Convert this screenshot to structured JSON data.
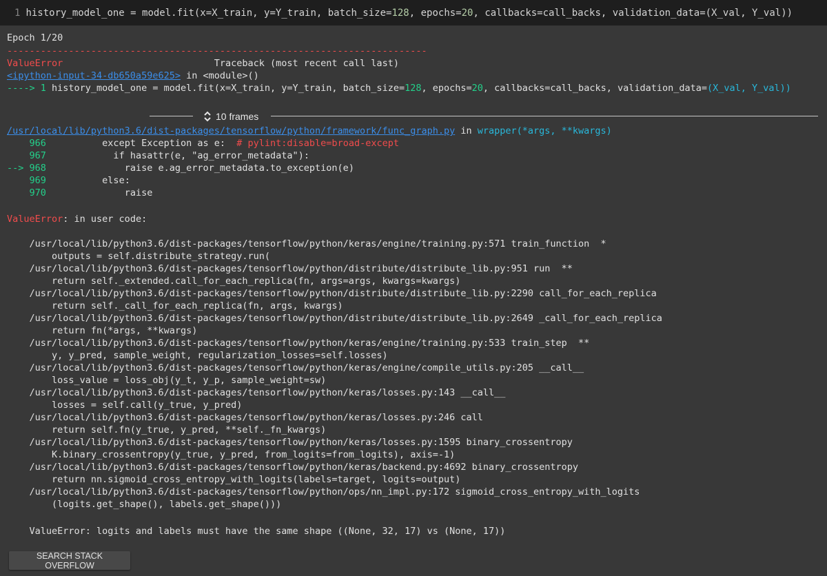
{
  "cell": {
    "line_number": "1",
    "code_prefix": "history_model_one = model.fit(x=X_train, y=Y_train, batch_size=",
    "batch_size": "128",
    "code_mid": ", epochs=",
    "epochs": "20",
    "code_suffix": ", callbacks=call_backs, validation_data=(X_val, Y_val))"
  },
  "output": {
    "epoch": "Epoch 1/20",
    "dash_rule": "---------------------------------------------------------------------------",
    "error_name": "ValueError",
    "traceback_header": "Traceback (most recent call last)",
    "ipython_link": "<ipython-input-34-db650a59e625>",
    "in_module": " in <module>()",
    "arrow_line_prefix": "----> 1 ",
    "arrow_code_a": "history_model_one = model.fit(x=X_train, y=Y_train, batch_size=",
    "arrow_bs": "128",
    "arrow_code_b": ", epochs=",
    "arrow_ep": "20",
    "arrow_code_c": ", callbacks=call_backs, validation_data=",
    "arrow_code_d": "(X_val, Y_val))",
    "frames_label": "10 frames",
    "file_link": "/usr/local/lib/python3.6/dist-packages/tensorflow/python/framework/func_graph.py",
    "file_in": " in ",
    "file_func": "wrapper(*args, **kwargs)",
    "src_lines": [
      {
        "marker": "    966 ",
        "code_kw": "         except",
        "code_rest": " Exception ",
        "code_as": "as",
        "code_tail": " e:  ",
        "comment": "# pylint:disable=broad-except"
      },
      {
        "marker": "    967 ",
        "code_kw": "           if",
        "code_rest": " hasattr(e, ",
        "code_str": "\"ag_error_metadata\"",
        "code_tail": "):"
      },
      {
        "marker": "--> 968 ",
        "code_kw": "             raise",
        "code_rest": " e.ag_error_metadata.to_exception(e)"
      },
      {
        "marker": "    969 ",
        "code_kw": "         else:"
      },
      {
        "marker": "    970 ",
        "code_kw": "             raise"
      }
    ],
    "user_code_err": "ValueError",
    "user_code_msg": ": in user code:",
    "stack": [
      "    /usr/local/lib/python3.6/dist-packages/tensorflow/python/keras/engine/training.py:571 train_function  *",
      "        outputs = self.distribute_strategy.run(",
      "    /usr/local/lib/python3.6/dist-packages/tensorflow/python/distribute/distribute_lib.py:951 run  **",
      "        return self._extended.call_for_each_replica(fn, args=args, kwargs=kwargs)",
      "    /usr/local/lib/python3.6/dist-packages/tensorflow/python/distribute/distribute_lib.py:2290 call_for_each_replica",
      "        return self._call_for_each_replica(fn, args, kwargs)",
      "    /usr/local/lib/python3.6/dist-packages/tensorflow/python/distribute/distribute_lib.py:2649 _call_for_each_replica",
      "        return fn(*args, **kwargs)",
      "    /usr/local/lib/python3.6/dist-packages/tensorflow/python/keras/engine/training.py:533 train_step  **",
      "        y, y_pred, sample_weight, regularization_losses=self.losses)",
      "    /usr/local/lib/python3.6/dist-packages/tensorflow/python/keras/engine/compile_utils.py:205 __call__",
      "        loss_value = loss_obj(y_t, y_p, sample_weight=sw)",
      "    /usr/local/lib/python3.6/dist-packages/tensorflow/python/keras/losses.py:143 __call__",
      "        losses = self.call(y_true, y_pred)",
      "    /usr/local/lib/python3.6/dist-packages/tensorflow/python/keras/losses.py:246 call",
      "        return self.fn(y_true, y_pred, **self._fn_kwargs)",
      "    /usr/local/lib/python3.6/dist-packages/tensorflow/python/keras/losses.py:1595 binary_crossentropy",
      "        K.binary_crossentropy(y_true, y_pred, from_logits=from_logits), axis=-1)",
      "    /usr/local/lib/python3.6/dist-packages/tensorflow/python/keras/backend.py:4692 binary_crossentropy",
      "        return nn.sigmoid_cross_entropy_with_logits(labels=target, logits=output)",
      "    /usr/local/lib/python3.6/dist-packages/tensorflow/python/ops/nn_impl.py:172 sigmoid_cross_entropy_with_logits",
      "        (logits.get_shape(), labels.get_shape()))"
    ],
    "final_error": "    ValueError: logits and labels must have the same shape ((None, 32, 17) vs (None, 17))"
  },
  "actions": {
    "search_so_label": "SEARCH STACK OVERFLOW"
  },
  "icons": {
    "frames_toggle": "unfold-more-icon"
  },
  "colors": {
    "background": "#383838",
    "cell_background": "#1e1e1e",
    "error_red": "#f14c4c",
    "green": "#23d18b",
    "link_blue": "#3b8eea"
  }
}
